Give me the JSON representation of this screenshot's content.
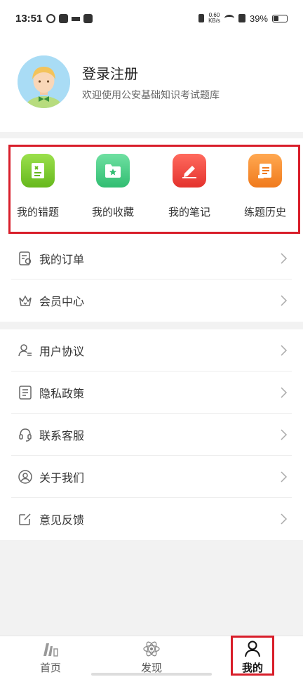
{
  "status_bar": {
    "time": "13:51",
    "net_speed_top": "0.60",
    "net_speed_unit": "KB/s",
    "battery": "39%"
  },
  "profile": {
    "title": "登录注册",
    "subtitle": "欢迎使用公安基础知识考试题库"
  },
  "quick_actions": [
    {
      "label": "我的错题",
      "icon": "wrong-answers-icon",
      "color": "#7ccb2e"
    },
    {
      "label": "我的收藏",
      "icon": "favorites-icon",
      "color": "#4ccf8a"
    },
    {
      "label": "我的笔记",
      "icon": "notes-icon",
      "color": "#f0453f"
    },
    {
      "label": "练题历史",
      "icon": "history-icon",
      "color": "#f78a2c"
    }
  ],
  "menu_group_1": [
    {
      "label": "我的订单",
      "icon": "order-icon"
    },
    {
      "label": "会员中心",
      "icon": "crown-icon"
    }
  ],
  "menu_group_2": [
    {
      "label": "用户协议",
      "icon": "user-agreement-icon"
    },
    {
      "label": "隐私政策",
      "icon": "privacy-policy-icon"
    },
    {
      "label": "联系客服",
      "icon": "headset-icon"
    },
    {
      "label": "关于我们",
      "icon": "about-icon"
    },
    {
      "label": "意见反馈",
      "icon": "feedback-icon"
    }
  ],
  "tabbar": [
    {
      "label": "首页",
      "icon": "home-icon"
    },
    {
      "label": "发现",
      "icon": "discover-icon"
    },
    {
      "label": "我的",
      "icon": "profile-icon",
      "active": true
    }
  ]
}
